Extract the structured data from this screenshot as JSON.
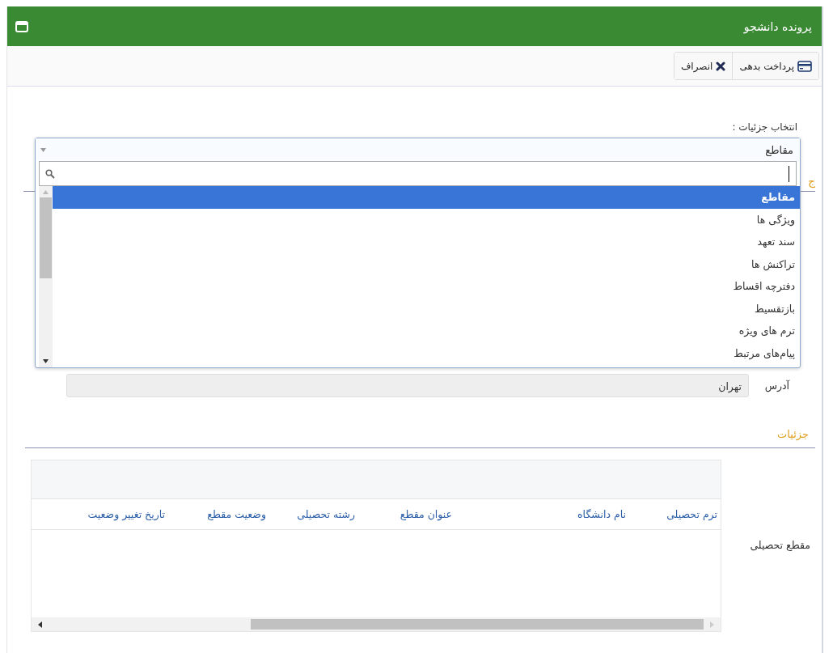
{
  "window": {
    "title": "پرونده دانشجو"
  },
  "toolbar": [
    {
      "kind": "card",
      "label": "پرداخت بدهی"
    },
    {
      "kind": "cancel",
      "label": "انصراف"
    }
  ],
  "details_select": {
    "label": "انتخاب جزئیات :",
    "value": "مقاطع",
    "expanded": true,
    "options": [
      {
        "label": "مقاطع",
        "selected": true
      },
      {
        "label": "ویژگی ها",
        "selected": false
      },
      {
        "label": "سند تعهد",
        "selected": false
      },
      {
        "label": "تراکنش ها",
        "selected": false
      },
      {
        "label": "دفترچه اقساط",
        "selected": false
      },
      {
        "label": "بازتقسیط",
        "selected": false
      },
      {
        "label": "ترم های ویژه",
        "selected": false
      },
      {
        "label": "پیام‌های مرتبط",
        "selected": false
      }
    ]
  },
  "hidden_heading": "ج",
  "address": {
    "label": "آدرس",
    "value": "تهران"
  },
  "details_heading": "جزئیات",
  "degrees_table": {
    "label": "مقطع تحصیلی",
    "columns": [
      "ترم تحصیلی",
      "نام دانشگاه",
      "عنوان مقطع",
      "رشته تحصیلی",
      "وضعیت مقطع",
      "تاریخ تغییر وضعیت"
    ]
  }
}
